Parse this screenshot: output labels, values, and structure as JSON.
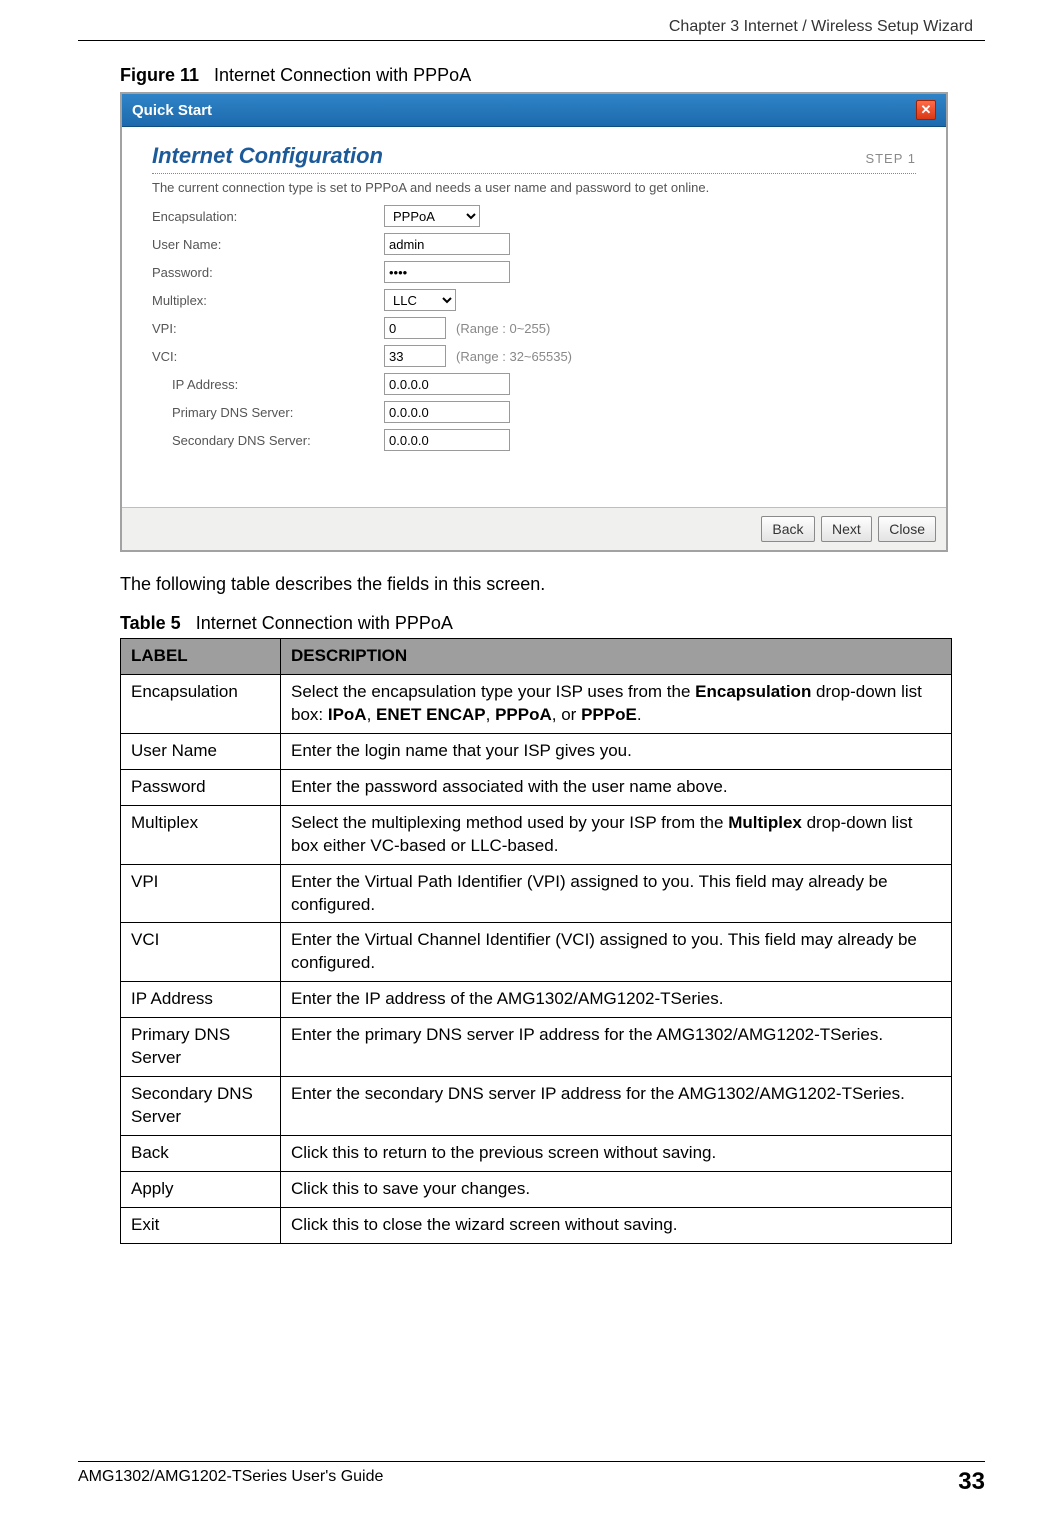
{
  "header": {
    "chapter": "Chapter 3 Internet / Wireless Setup Wizard"
  },
  "figure": {
    "label": "Figure 11",
    "title": "Internet Connection with PPPoA"
  },
  "wizard": {
    "titlebar": "Quick Start",
    "close_text": "✕",
    "section_title": "Internet Configuration",
    "step": "STEP 1",
    "description": "The current connection type is set to PPPoA and needs a user name and password to get online.",
    "fields": {
      "encapsulation": {
        "label": "Encapsulation:",
        "value": "PPPoA"
      },
      "username": {
        "label": "User Name:",
        "value": "admin"
      },
      "password": {
        "label": "Password:",
        "value": "••••"
      },
      "multiplex": {
        "label": "Multiplex:",
        "value": "LLC"
      },
      "vpi": {
        "label": "VPI:",
        "value": "0",
        "range": "(Range : 0~255)"
      },
      "vci": {
        "label": "VCI:",
        "value": "33",
        "range": "(Range : 32~65535)"
      },
      "ip": {
        "label": "IP Address:",
        "value": "0.0.0.0"
      },
      "dns1": {
        "label": "Primary DNS Server:",
        "value": "0.0.0.0"
      },
      "dns2": {
        "label": "Secondary DNS Server:",
        "value": "0.0.0.0"
      }
    },
    "buttons": {
      "back": "Back",
      "next": "Next",
      "close": "Close"
    }
  },
  "intro_text": "The following table describes the fields in this screen.",
  "table": {
    "label": "Table 5",
    "title": "Internet Connection with PPPoA",
    "headers": {
      "col1": "LABEL",
      "col2": "DESCRIPTION"
    },
    "rows": [
      {
        "label": "Encapsulation",
        "desc_pre": "Select the encapsulation type your ISP uses from the ",
        "b1": "Encapsulation",
        "desc_mid": " drop-down list box: ",
        "b2": "IPoA",
        "c2": ", ",
        "b3": "ENET ENCAP",
        "c3": ", ",
        "b4": "PPPoA",
        "c4": ", or ",
        "b5": "PPPoE",
        "desc_post": "."
      },
      {
        "label": "User Name",
        "desc": "Enter the login name that your ISP gives you."
      },
      {
        "label": "Password",
        "desc": "Enter the password associated with the user name above."
      },
      {
        "label": "Multiplex",
        "desc_pre": "Select the multiplexing method used by your ISP from the ",
        "b1": "Multiplex",
        "desc_post": " drop-down list box either VC-based or LLC-based."
      },
      {
        "label": "VPI",
        "desc": "Enter the Virtual Path Identifier (VPI) assigned to you. This field may already be configured."
      },
      {
        "label": "VCI",
        "desc": "Enter the Virtual Channel Identifier (VCI) assigned to you. This field may already be configured."
      },
      {
        "label": "IP Address",
        "desc": "Enter the IP address of the AMG1302/AMG1202-TSeries."
      },
      {
        "label": "Primary DNS Server",
        "desc": "Enter the primary DNS server IP address for the AMG1302/AMG1202-TSeries."
      },
      {
        "label": "Secondary DNS Server",
        "desc": "Enter the secondary DNS server IP address for the AMG1302/AMG1202-TSeries."
      },
      {
        "label": "Back",
        "desc": "Click this to return to the previous screen without saving."
      },
      {
        "label": "Apply",
        "desc": "Click this to save your changes."
      },
      {
        "label": "Exit",
        "desc": "Click this to close the wizard screen without saving."
      }
    ]
  },
  "footer": {
    "guide": "AMG1302/AMG1202-TSeries User's Guide",
    "page": "33"
  }
}
